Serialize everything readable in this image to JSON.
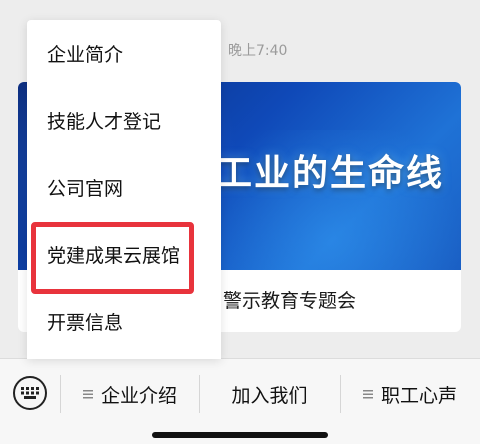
{
  "chat": {
    "timestamp": "晚上7:40",
    "card": {
      "banner_text": "工业的生命线",
      "caption": "警示教育专题会"
    }
  },
  "popup_menu": {
    "items": [
      {
        "label": "企业简介"
      },
      {
        "label": "技能人才登记"
      },
      {
        "label": "公司官网"
      },
      {
        "label": "党建成果云展馆"
      },
      {
        "label": "开票信息"
      }
    ],
    "highlighted_item": "党建成果云展馆",
    "highlight_color": "#e8333c"
  },
  "bottom_bar": {
    "keyboard_icon": "keyboard-icon",
    "items": [
      {
        "label": "企业介绍",
        "icon": "list-icon"
      },
      {
        "label": "加入我们"
      },
      {
        "label": "职工心声",
        "icon": "list-icon"
      }
    ]
  }
}
